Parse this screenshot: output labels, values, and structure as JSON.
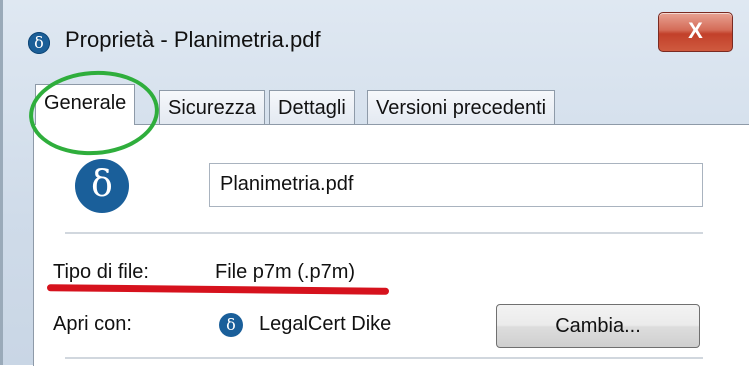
{
  "window": {
    "title": "Proprietà - Planimetria.pdf",
    "close_label": "X"
  },
  "tabs": [
    {
      "label": "Generale",
      "active": true
    },
    {
      "label": "Sicurezza",
      "active": false
    },
    {
      "label": "Dettagli",
      "active": false
    },
    {
      "label": "Versioni precedenti",
      "active": false
    }
  ],
  "general": {
    "file_name_value": "Planimetria.pdf",
    "file_type_label": "Tipo di file:",
    "file_type_value": "File p7m (.p7m)",
    "open_with_label": "Apri con:",
    "open_with_app": "LegalCert Dike",
    "change_button": "Cambia..."
  },
  "icons": {
    "app_glyph": "δ",
    "app_icon_name": "dike-delta-icon"
  },
  "colors": {
    "annotation_circle": "#2fae3c",
    "annotation_underline": "#d6121d",
    "app_icon": "#1a5f9a",
    "close_button": "#c2402a"
  }
}
